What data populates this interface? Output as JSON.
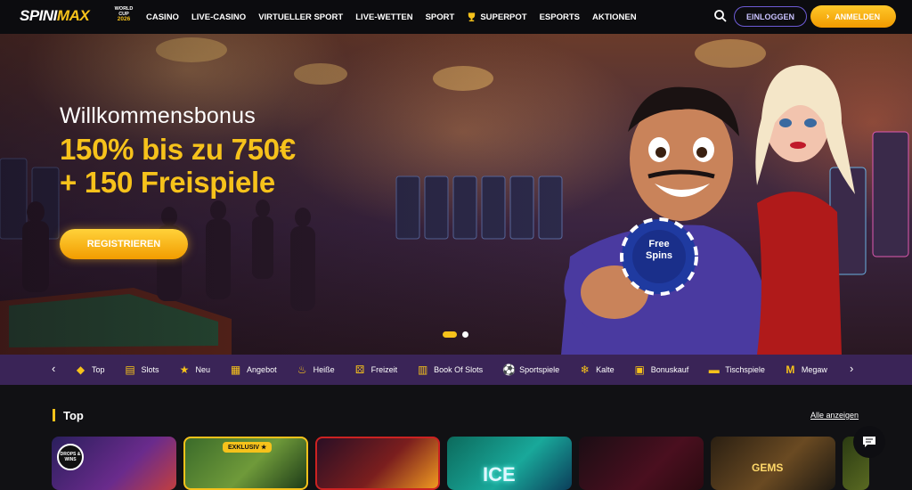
{
  "brand": {
    "logo_main": "SPINI",
    "logo_accent": "MAX",
    "wc_line1": "WORLD",
    "wc_line2": "CUP",
    "wc_year": "2026"
  },
  "nav": {
    "items": [
      "CASINO",
      "LIVE-CASINO",
      "VIRTUELLER SPORT",
      "LIVE-WETTEN",
      "SPORT",
      "SUPERPOT",
      "ESPORTS",
      "AKTIONEN"
    ],
    "login": "EINLOGGEN",
    "signup": "ANMELDEN"
  },
  "hero": {
    "title": "Willkommensbonus",
    "line1": "150% bis zu 750€",
    "line2": "+ 150 Freispiele",
    "cta": "REGISTRIEREN",
    "chip_text": "Free Spins",
    "slides": 2,
    "active_slide": 1
  },
  "categories": [
    {
      "label": "Top",
      "icon": "diamond-icon"
    },
    {
      "label": "Slots",
      "icon": "slot-machine-icon"
    },
    {
      "label": "Neu",
      "icon": "star-icon"
    },
    {
      "label": "Angebot",
      "icon": "calendar-icon"
    },
    {
      "label": "Heiße",
      "icon": "flame-icon"
    },
    {
      "label": "Freizeit",
      "icon": "dice-icon"
    },
    {
      "label": "Book Of Slots",
      "icon": "book-icon"
    },
    {
      "label": "Sportspiele",
      "icon": "ball-icon"
    },
    {
      "label": "Kalte",
      "icon": "snowflake-icon"
    },
    {
      "label": "Bonuskauf",
      "icon": "gift-icon"
    },
    {
      "label": "Tischspiele",
      "icon": "table-icon"
    },
    {
      "label": "Megaw",
      "icon": "megaways-icon"
    }
  ],
  "section": {
    "title": "Top",
    "show_all": "Alle anzeigen"
  },
  "tiles": [
    {
      "badge": "DROPS & WINS"
    },
    {
      "badge": "EXKLUSIV ★"
    },
    {
      "badge": ""
    },
    {
      "label": "ICE"
    },
    {
      "badge": ""
    },
    {
      "label": "GEMS"
    },
    {
      "badge": ""
    }
  ],
  "colors": {
    "accent": "#f6c21b",
    "catbar": "#3a2457",
    "login_border": "#6d5bd6",
    "bg": "#111114"
  }
}
